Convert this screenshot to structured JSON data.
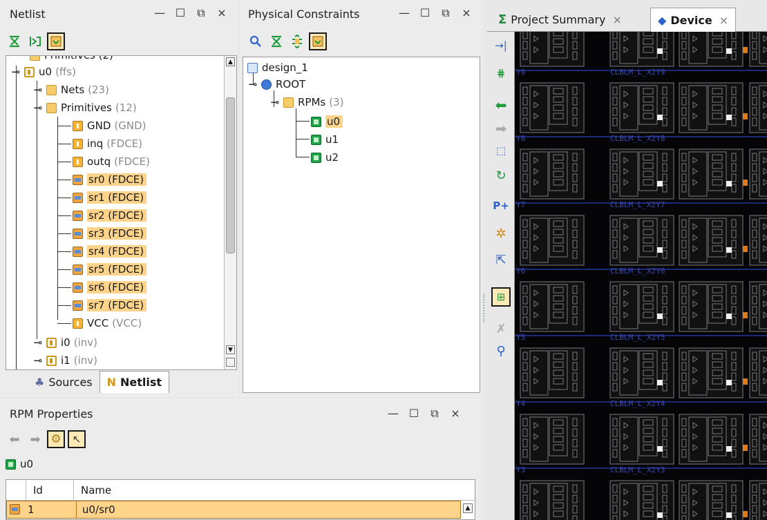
{
  "netlist_panel": {
    "title": "Netlist",
    "tree": {
      "partial_top": "Primitives (2)",
      "u0": {
        "name": "u0",
        "type": "(ffs)"
      },
      "nets": {
        "label": "Nets",
        "count": "(23)"
      },
      "primitives": {
        "label": "Primitives",
        "count": "(12)"
      },
      "leaves": [
        {
          "name": "GND",
          "type": "(GND)",
          "highlight": false,
          "icon": "cell"
        },
        {
          "name": "inq",
          "type": "(FDCE)",
          "highlight": false,
          "icon": "cell"
        },
        {
          "name": "outq",
          "type": "(FDCE)",
          "highlight": false,
          "icon": "cell"
        },
        {
          "name": "sr0 (FDCE)",
          "type": "",
          "highlight": true,
          "icon": "bus"
        },
        {
          "name": "sr1 (FDCE)",
          "type": "",
          "highlight": true,
          "icon": "bus"
        },
        {
          "name": "sr2 (FDCE)",
          "type": "",
          "highlight": true,
          "icon": "bus"
        },
        {
          "name": "sr3 (FDCE)",
          "type": "",
          "highlight": true,
          "icon": "bus"
        },
        {
          "name": "sr4 (FDCE)",
          "type": "",
          "highlight": true,
          "icon": "bus"
        },
        {
          "name": "sr5 (FDCE)",
          "type": "",
          "highlight": true,
          "icon": "bus"
        },
        {
          "name": "sr6 (FDCE)",
          "type": "",
          "highlight": true,
          "icon": "bus"
        },
        {
          "name": "sr7 (FDCE)",
          "type": "",
          "highlight": true,
          "icon": "bus"
        },
        {
          "name": "VCC",
          "type": "(VCC)",
          "highlight": false,
          "icon": "cell"
        }
      ],
      "i0": {
        "name": "i0",
        "type": "(inv)"
      },
      "i1": {
        "name": "i1",
        "type": "(inv)"
      }
    },
    "tabs": {
      "sources": "Sources",
      "netlist": "Netlist"
    }
  },
  "constraints_panel": {
    "title": "Physical Constraints",
    "design": "design_1",
    "root": "ROOT",
    "rpms": {
      "label": "RPMs",
      "count": "(3)"
    },
    "items": [
      "u0",
      "u1",
      "u2"
    ]
  },
  "rpm_properties": {
    "title": "RPM Properties",
    "selected": "u0",
    "columns": [
      "Id",
      "Name"
    ],
    "rows": [
      {
        "id": "1",
        "name": "u0/sr0"
      }
    ]
  },
  "device_view": {
    "tabs": [
      "Project Summary",
      "Device"
    ],
    "close_glyph": "×",
    "site_rows": [
      "Y9",
      "Y8",
      "Y7",
      "Y6",
      "Y5",
      "Y4",
      "Y3",
      "Y2"
    ],
    "site_prefix": "CLBLM_L_X2"
  },
  "window_ctrls": [
    "—",
    "☐",
    "⧉",
    "×"
  ],
  "colors": {
    "highlight": "#fdd48a",
    "device_bg": "#050508",
    "tile_line": "#7a7a80",
    "grid_blue": "#1c2a7a"
  }
}
